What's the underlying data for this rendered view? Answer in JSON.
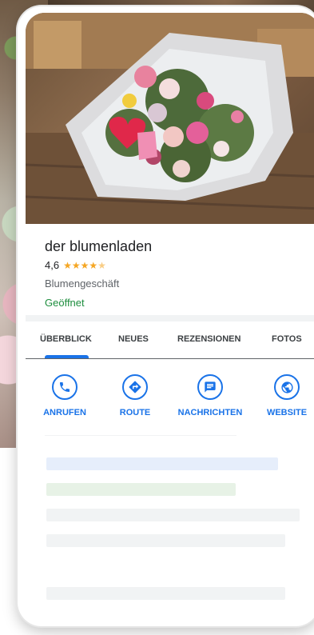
{
  "place": {
    "name": "der blumenladen",
    "rating": "4,6",
    "rating_stars": 4.6,
    "category": "Blumengeschäft",
    "status": "Geöffnet"
  },
  "tabs": [
    {
      "label": "ÜBERBLICK",
      "active": true
    },
    {
      "label": "NEUES"
    },
    {
      "label": "REZENSIONEN"
    },
    {
      "label": "FOTOS"
    }
  ],
  "actions": [
    {
      "label": "ANRUFEN",
      "icon": "phone-icon"
    },
    {
      "label": "ROUTE",
      "icon": "directions-icon"
    },
    {
      "label": "NACHRICHTEN",
      "icon": "message-icon"
    },
    {
      "label": "WEBSITE",
      "icon": "globe-icon"
    }
  ],
  "colors": {
    "accent": "#1a73e8",
    "open": "#1e8e3e",
    "stars": "#f5a623"
  }
}
